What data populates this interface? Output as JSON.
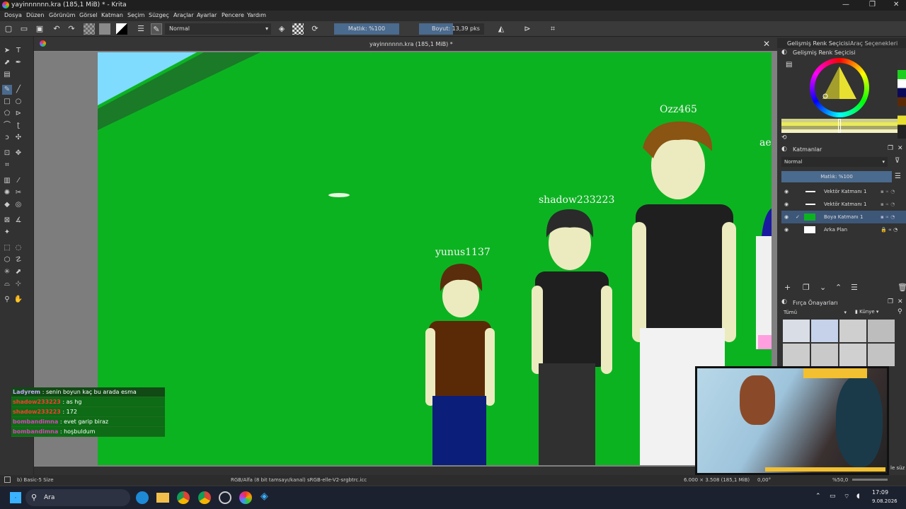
{
  "window": {
    "title": "yayinnnnnn.kra (185,1 MiB) * - Krita"
  },
  "menu": [
    "Dosya",
    "Düzen",
    "Görünüm",
    "Görsel",
    "Katman",
    "Seçim",
    "Süzgeç",
    "Araçlar",
    "Ayarlar",
    "Pencere",
    "Yardım"
  ],
  "toolbar": {
    "blend_mode": "Normal",
    "opacity": "Matlık: %100",
    "size": "Boyut: 13,39 pks"
  },
  "document": {
    "tab_title": "yayinnnnnn.kra (185,1 MiB) *"
  },
  "canvas": {
    "names": [
      "yunus1137",
      "shadow233223",
      "Ozz465",
      "aet"
    ]
  },
  "chat": [
    {
      "user": "Ladyrem",
      "msg": ": senin boyun kaç bu arada esma",
      "color": "#c9a7ff"
    },
    {
      "user": "shadow233223",
      "msg": ": as hg",
      "color": "#ff3b2f"
    },
    {
      "user": "shadow233223",
      "msg": ": 172",
      "color": "#ff3b2f"
    },
    {
      "user": "bombandimna",
      "msg": ": evet garip biraz",
      "color": "#e040c0"
    },
    {
      "user": "bombandimna",
      "msg": ": hoşbuldum",
      "color": "#e040c0"
    }
  ],
  "right": {
    "tab1": "Gelişmiş Renk Seçicisi",
    "tab2": "Araç Seçenekleri",
    "color_title": "Gelişmiş Renk Seçicisi",
    "layers_title": "Katmanlar",
    "layers_mode": "Normal",
    "layers_opacity": "Matlık: %100",
    "layers": [
      "Vektör Katmanı 1",
      "Vektör Katmanı 1",
      "Boya Katmanı 1",
      "Arka Plan"
    ],
    "brush_title": "Fırça Önayarları",
    "brush_filter": "Tümü",
    "brush_tag": "Künye",
    "brush_search": "le süz"
  },
  "status": {
    "brush": "b) Basic-5 Size",
    "colorspace": "RGB/Alfa (8 bit tamsayı/kanal) sRGB-elle-V2-srgbtrc.icc",
    "dims": "6.000 × 3.508 (185,1 MiB)",
    "angle": "0,00°",
    "zoom": "%50,0"
  },
  "taskbar": {
    "search": "Ara",
    "time": "17:09",
    "date": "9.08.2026"
  }
}
